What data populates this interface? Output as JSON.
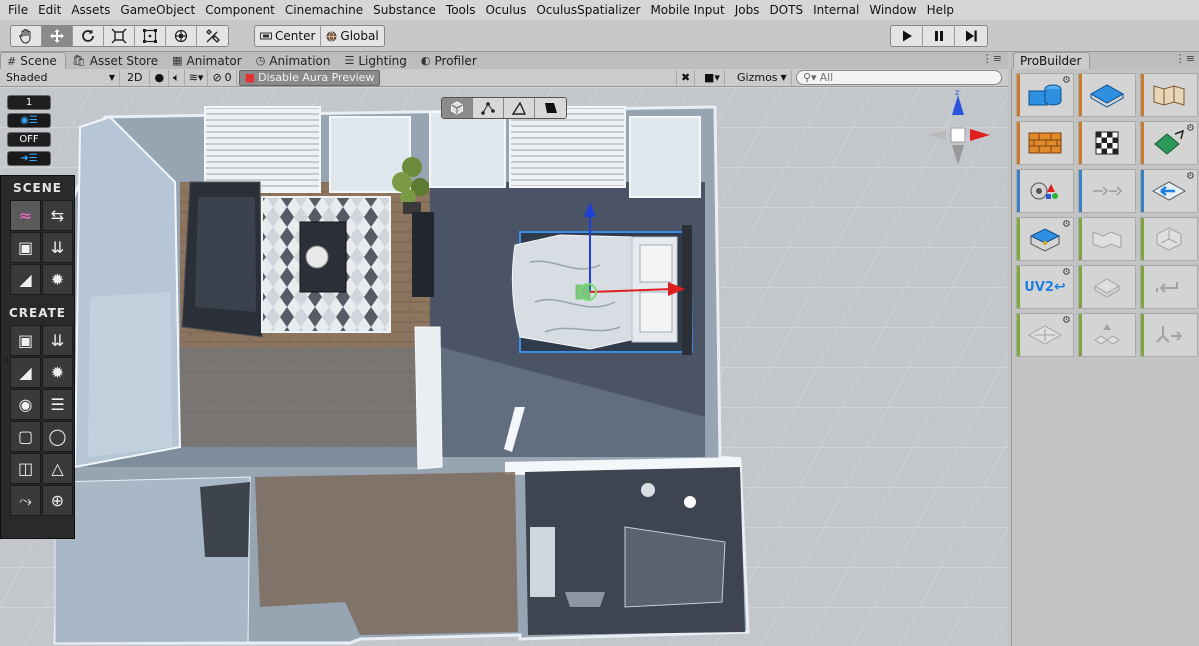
{
  "menu": [
    "File",
    "Edit",
    "Assets",
    "GameObject",
    "Component",
    "Cinemachine",
    "Substance",
    "Tools",
    "Oculus",
    "OculusSpatializer",
    "Mobile Input",
    "Jobs",
    "DOTS",
    "Internal",
    "Window",
    "Help"
  ],
  "toolbar": {
    "transform_tools": [
      "hand-icon",
      "move-icon",
      "rotate-icon",
      "scale-icon",
      "rect-transform-icon",
      "transform-icon",
      "custom-tool-icon"
    ],
    "active_tool": "move-icon",
    "pivot_mode": "Center",
    "pivot_rotation": "Global",
    "playback": [
      "play-icon",
      "pause-icon",
      "step-icon"
    ]
  },
  "tabs": [
    {
      "label": "Scene",
      "icon": "grid-icon",
      "active": true
    },
    {
      "label": "Asset Store",
      "icon": "bag-icon",
      "active": false
    },
    {
      "label": "Animator",
      "icon": "animator-icon",
      "active": false
    },
    {
      "label": "Animation",
      "icon": "clock-icon",
      "active": false
    },
    {
      "label": "Lighting",
      "icon": "bulb-icon",
      "active": false
    },
    {
      "label": "Profiler",
      "icon": "gauge-icon",
      "active": false
    }
  ],
  "scene_bar": {
    "shading": "Shaded",
    "mode_2d": "2D",
    "hidden_count": "0",
    "aura_label": "Disable Aura Preview",
    "gizmos": "Gizmos",
    "search_placeholder": "All"
  },
  "overlay_toggles": [
    "1",
    "OFF"
  ],
  "palette": {
    "scene_title": "SCENE",
    "create_title": "CREATE"
  },
  "shading_modes": [
    "object-mode-icon",
    "vertex-mode-icon",
    "edge-mode-icon",
    "face-mode-icon"
  ],
  "probuilder": {
    "title": "ProBuilder",
    "uv_label": "UV2",
    "stripe_colors": {
      "orange": "#c97a2a",
      "blue": "#3b7fc4",
      "green": "#7aa83c"
    }
  },
  "colors": {
    "accent_blue": "#3a8ee6",
    "gizmo_red": "#e02020",
    "gizmo_blue": "#1e3fd8",
    "gizmo_green": "#2fb42f"
  }
}
